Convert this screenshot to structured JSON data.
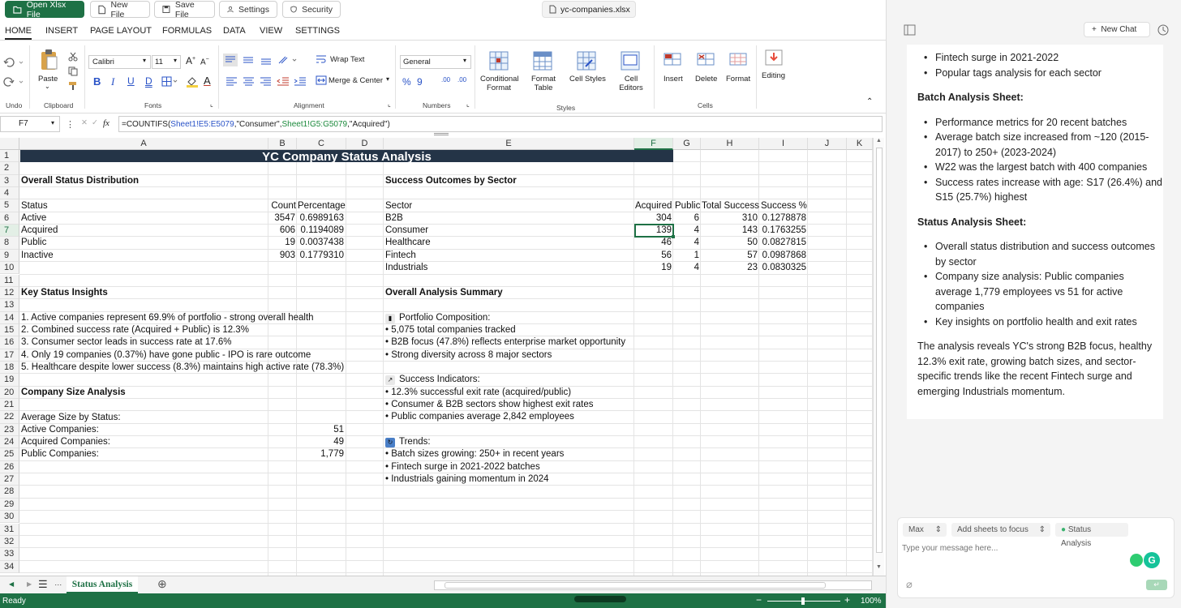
{
  "topbar": {
    "open_label": "Open Xlsx File",
    "new_label": "New File",
    "save_label": "Save File",
    "settings_label": "Settings",
    "security_label": "Security",
    "filename": "yc-companies.xlsx"
  },
  "tabs": [
    "HOME",
    "INSERT",
    "PAGE LAYOUT",
    "FORMULAS",
    "DATA",
    "VIEW",
    "SETTINGS"
  ],
  "ribbon": {
    "undo": "Undo",
    "clipboard": "Clipboard",
    "paste": "Paste",
    "font_name": "Calibri",
    "font_size": "11",
    "fonts": "Fonts",
    "wrap_text": "Wrap Text",
    "merge_center": "Merge & Center",
    "alignment": "Alignment",
    "number_format": "General",
    "numbers": "Numbers",
    "conditional_format": "Conditional Format",
    "format_table": "Format Table",
    "cell_styles": "Cell Styles",
    "cell_editors": "Cell Editors",
    "styles": "Styles",
    "insert": "Insert",
    "delete": "Delete",
    "format": "Format",
    "cells": "Cells",
    "editing": "Editing"
  },
  "formula_bar": {
    "name_box": "F7",
    "fx": "fx",
    "p1": "=COUNTIFS(",
    "ref1": "Sheet1!E5:E5079",
    "p2": ",\"Consumer\",",
    "ref2": "Sheet1!G5:G5079",
    "p3": ",\"Acquired\")"
  },
  "columns": [
    "A",
    "B",
    "C",
    "D",
    "E",
    "F",
    "G",
    "H",
    "I",
    "J",
    "K"
  ],
  "selected_column": "F",
  "selected_row": 7,
  "rows": 34,
  "sheet": {
    "title": "YC Company Status Analysis",
    "dist_header": "Overall Status Distribution",
    "dist_cols": [
      "Status",
      "Count",
      "Percentage"
    ],
    "dist_rows": [
      [
        "Active",
        "3547",
        "0.6989163"
      ],
      [
        "Acquired",
        "606",
        "0.1194089"
      ],
      [
        "Public",
        "19",
        "0.0037438"
      ],
      [
        "Inactive",
        "903",
        "0.1779310"
      ]
    ],
    "sector_header": "Success Outcomes by Sector",
    "sector_cols": [
      "Sector",
      "Acquired",
      "Public",
      "Total Success",
      "Success %"
    ],
    "sector_rows": [
      [
        "B2B",
        "304",
        "6",
        "310",
        "0.1278878"
      ],
      [
        "Consumer",
        "139",
        "4",
        "143",
        "0.1763255"
      ],
      [
        "Healthcare",
        "46",
        "4",
        "50",
        "0.0827815"
      ],
      [
        "Fintech",
        "56",
        "1",
        "57",
        "0.0987868"
      ],
      [
        "Industrials",
        "19",
        "4",
        "23",
        "0.0830325"
      ]
    ],
    "insights_header": "Key Status Insights",
    "insights": [
      "1. Active companies represent 69.9% of portfolio - strong overall health",
      "2. Combined success rate (Acquired + Public) is 12.3%",
      "3. Consumer sector leads in success rate at 17.6%",
      "4. Only 19 companies (0.37%) have gone public - IPO is rare outcome",
      "5. Healthcare despite lower success (8.3%) maintains high active rate (78.3%)"
    ],
    "size_header": "Company Size Analysis",
    "size_sub": "Average Size by Status:",
    "size_rows": [
      [
        "Active Companies:",
        "51"
      ],
      [
        "Acquired Companies:",
        "49"
      ],
      [
        "Public Companies:",
        "1,779"
      ]
    ],
    "summary_header": "Overall Analysis Summary",
    "summary_lines": [
      "Portfolio Composition:",
      "• 5,075 total companies tracked",
      "• B2B focus (47.8%) reflects enterprise market opportunity",
      "• Strong diversity across 8 major sectors",
      "",
      "Success Indicators:",
      "• 12.3% successful exit rate (acquired/public)",
      "• Consumer & B2B sectors show highest exit rates",
      "• Public companies average 2,842 employees",
      "",
      "Trends:",
      "• Batch sizes growing: 250+ in recent years",
      "• Fintech surge in 2021-2022 batches",
      "• Industrials gaining momentum in 2024"
    ]
  },
  "sheet_tab": "Status Analysis",
  "status": {
    "ready": "Ready",
    "zoom": "100%"
  },
  "panel": {
    "new_chat": "New Chat",
    "lead_items": [
      "Fintech surge in 2021-2022",
      "Popular tags analysis for each sector"
    ],
    "batch_title": "Batch Analysis Sheet",
    "batch_items": [
      "Performance metrics for 20 recent batches",
      "Average batch size increased from ~120 (2015-2017) to 250+ (2023-2024)",
      "W22 was the largest batch with 400 companies",
      "Success rates increase with age: S17 (26.4%) and S15 (25.7%) highest"
    ],
    "status_title": "Status Analysis Sheet",
    "status_items": [
      "Overall status distribution and success outcomes by sector",
      "Company size analysis: Public companies average 1,779 employees vs 51 for active companies",
      "Key insights on portfolio health and exit rates"
    ],
    "conclusion": "The analysis reveals YC's strong B2B focus, healthy 12.3% exit rate, growing batch sizes, and sector-specific trends like the recent Fintech surge and emerging Industrials momentum.",
    "mode": "Max",
    "add_sheets": "Add sheets to focus",
    "focus_sheet": "Status Analysis",
    "placeholder": "Type your message here..."
  }
}
